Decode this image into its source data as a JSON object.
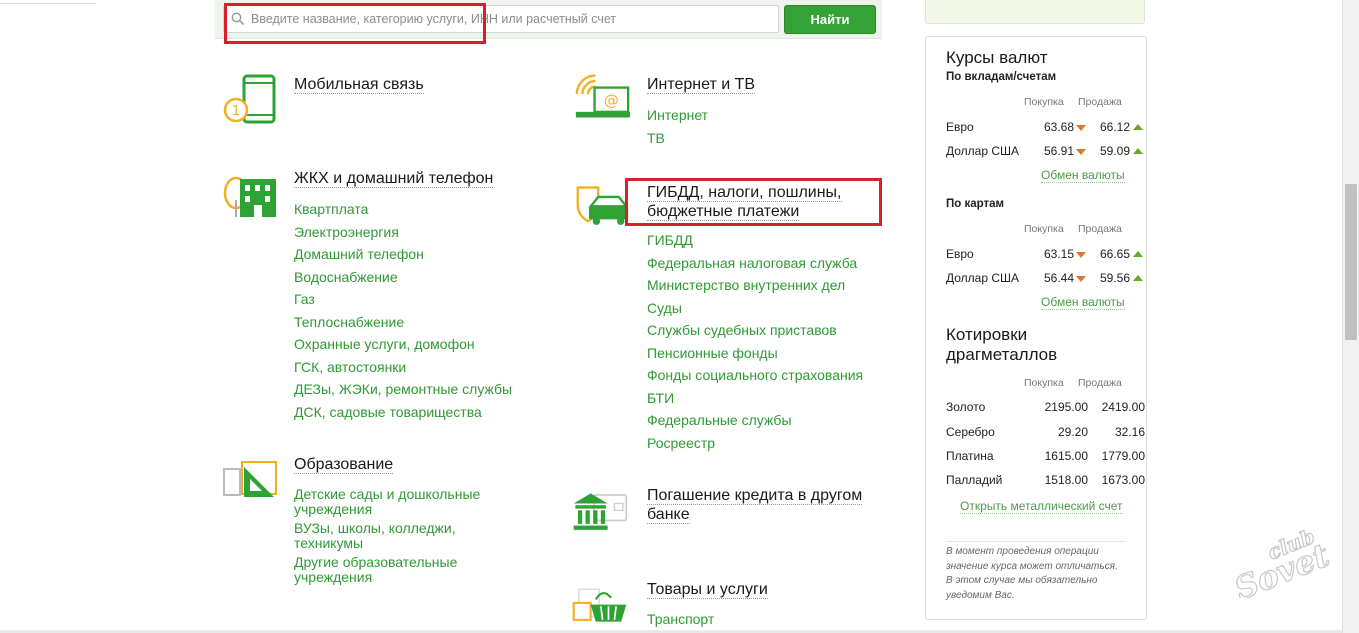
{
  "search": {
    "placeholder": "Введите название, категорию услуги, ИНН или расчетный счет",
    "button_label": "Найти"
  },
  "categories": [
    {
      "title": "Мобильная связь",
      "icon": "mobile-phone-icon",
      "links": []
    },
    {
      "title": "ЖКХ и домашний телефон",
      "icon": "apartment-building-icon",
      "links": [
        "Квартплата",
        "Электроэнергия",
        "Домашний телефон",
        "Водоснабжение",
        "Газ",
        "Теплоснабжение",
        "Охранные услуги, домофон",
        "ГСК, автостоянки",
        "ДЕЗы, ЖЭКи, ремонтные службы",
        "ДСК, садовые товарищества"
      ]
    },
    {
      "title": "Образование",
      "icon": "education-triangle-icon",
      "links": [
        "Детские сады и дошкольные учреждения",
        "ВУЗы, школы, колледжи, техникумы",
        "Другие образовательные учреждения"
      ]
    },
    {
      "title": "Интернет и ТВ",
      "icon": "internet-tv-icon",
      "links": [
        "Интернет",
        "ТВ"
      ]
    },
    {
      "title_line1": "ГИБДД, налоги, пошлины,",
      "title_line2": "бюджетные платежи",
      "icon": "police-car-shield-icon",
      "links": [
        "ГИБДД",
        "Федеральная налоговая служба",
        "Министерство внутренних дел",
        "Суды",
        "Службы судебных приставов",
        "Пенсионные фонды",
        "Фонды социального страхования",
        "БТИ",
        "Федеральные службы",
        "Росреестр"
      ]
    },
    {
      "title_line1": "Погашение кредита в другом",
      "title_line2": "банке",
      "icon": "bank-building-icon",
      "links": []
    },
    {
      "title": "Товары и услуги",
      "icon": "shopping-basket-icon",
      "links": [
        "Транспорт"
      ]
    }
  ],
  "rates": {
    "title": "Курсы валют",
    "deposits_label": "По вкладам/счетам",
    "cards_label": "По картам",
    "buy_label": "Покупка",
    "sell_label": "Продажа",
    "deposit_rows": [
      {
        "name": "Евро",
        "buy": "63.68",
        "sell": "66.12"
      },
      {
        "name": "Доллар США",
        "buy": "56.91",
        "sell": "59.09"
      }
    ],
    "card_rows": [
      {
        "name": "Евро",
        "buy": "63.15",
        "sell": "66.65"
      },
      {
        "name": "Доллар США",
        "buy": "56.44",
        "sell": "59.56"
      }
    ],
    "exchange_link": "Обмен валюты",
    "metals_title_line1": "Котировки",
    "metals_title_line2": "драгметаллов",
    "metal_rows": [
      {
        "name": "Золото",
        "buy": "2195.00",
        "sell": "2419.00"
      },
      {
        "name": "Серебро",
        "buy": "29.20",
        "sell": "32.16"
      },
      {
        "name": "Платина",
        "buy": "1615.00",
        "sell": "1779.00"
      },
      {
        "name": "Палладий",
        "buy": "1518.00",
        "sell": "1673.00"
      }
    ],
    "metal_account_link": "Открыть металлический счет",
    "note": "В момент проведения операции значение курса может отличаться. В этом случае мы обязательно уведомим Вас."
  },
  "watermark": {
    "line1": "club",
    "line2": "Sovet"
  },
  "colors": {
    "accent": "#35a235",
    "link": "#2f9a34",
    "highlight": "#d9202a",
    "down": "#e0782a",
    "up": "#6aaa1e"
  }
}
